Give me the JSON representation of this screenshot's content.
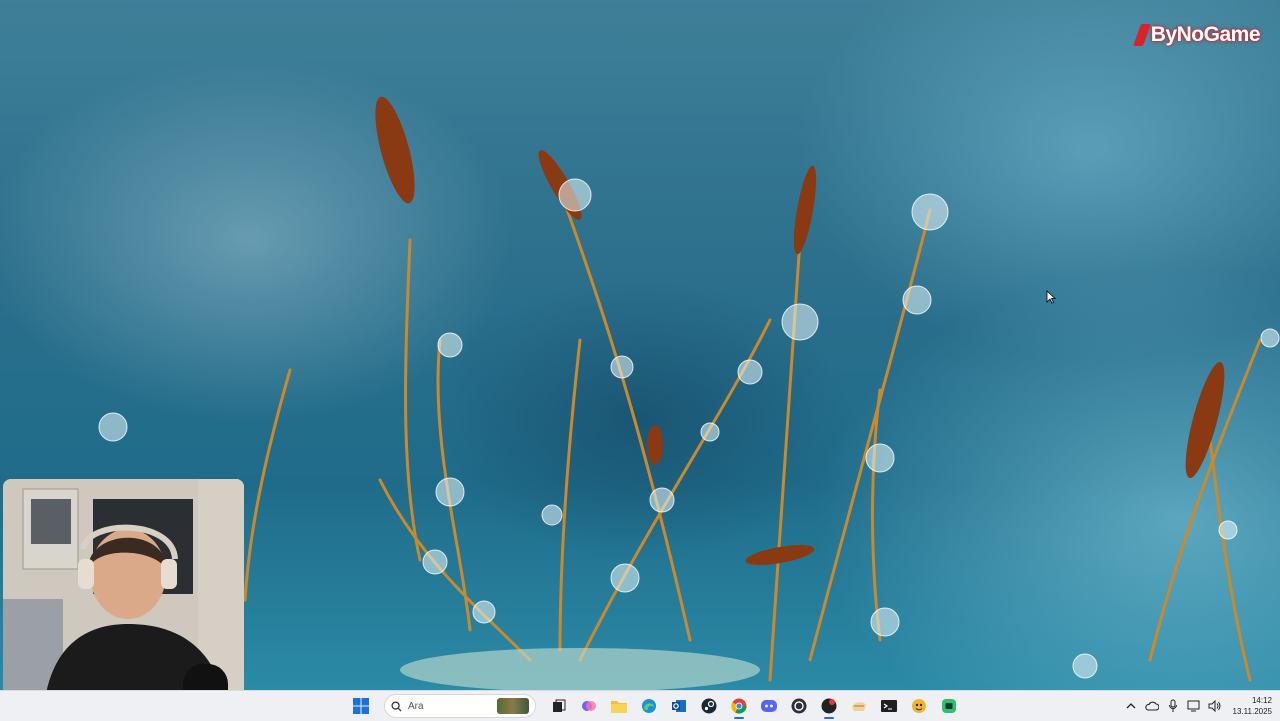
{
  "brand": {
    "logo_text": "ByNoGame"
  },
  "taskbar": {
    "start_icon": "windows-logo-icon",
    "search": {
      "placeholder": "Ara"
    },
    "pinned_apps": [
      {
        "name": "task-view-icon"
      },
      {
        "name": "copilot-icon"
      },
      {
        "name": "file-explorer-icon"
      },
      {
        "name": "edge-icon"
      },
      {
        "name": "outlook-icon"
      },
      {
        "name": "steam-icon"
      },
      {
        "name": "chrome-icon"
      },
      {
        "name": "discord-icon"
      },
      {
        "name": "obs-icon"
      },
      {
        "name": "recording-app-icon"
      },
      {
        "name": "notes-icon"
      },
      {
        "name": "terminal-icon"
      },
      {
        "name": "game-app-icon"
      },
      {
        "name": "chat-app-icon"
      }
    ],
    "tray": {
      "icons": [
        "chevron-up-icon",
        "cloud-icon",
        "microphone-icon",
        "display-icon",
        "speaker-icon"
      ],
      "time": "14:12",
      "date": "13.11.2025"
    }
  },
  "colors": {
    "taskbar_bg": "#eef0f3",
    "accent": "#2b6fd6",
    "brand_red": "#d7232b"
  }
}
